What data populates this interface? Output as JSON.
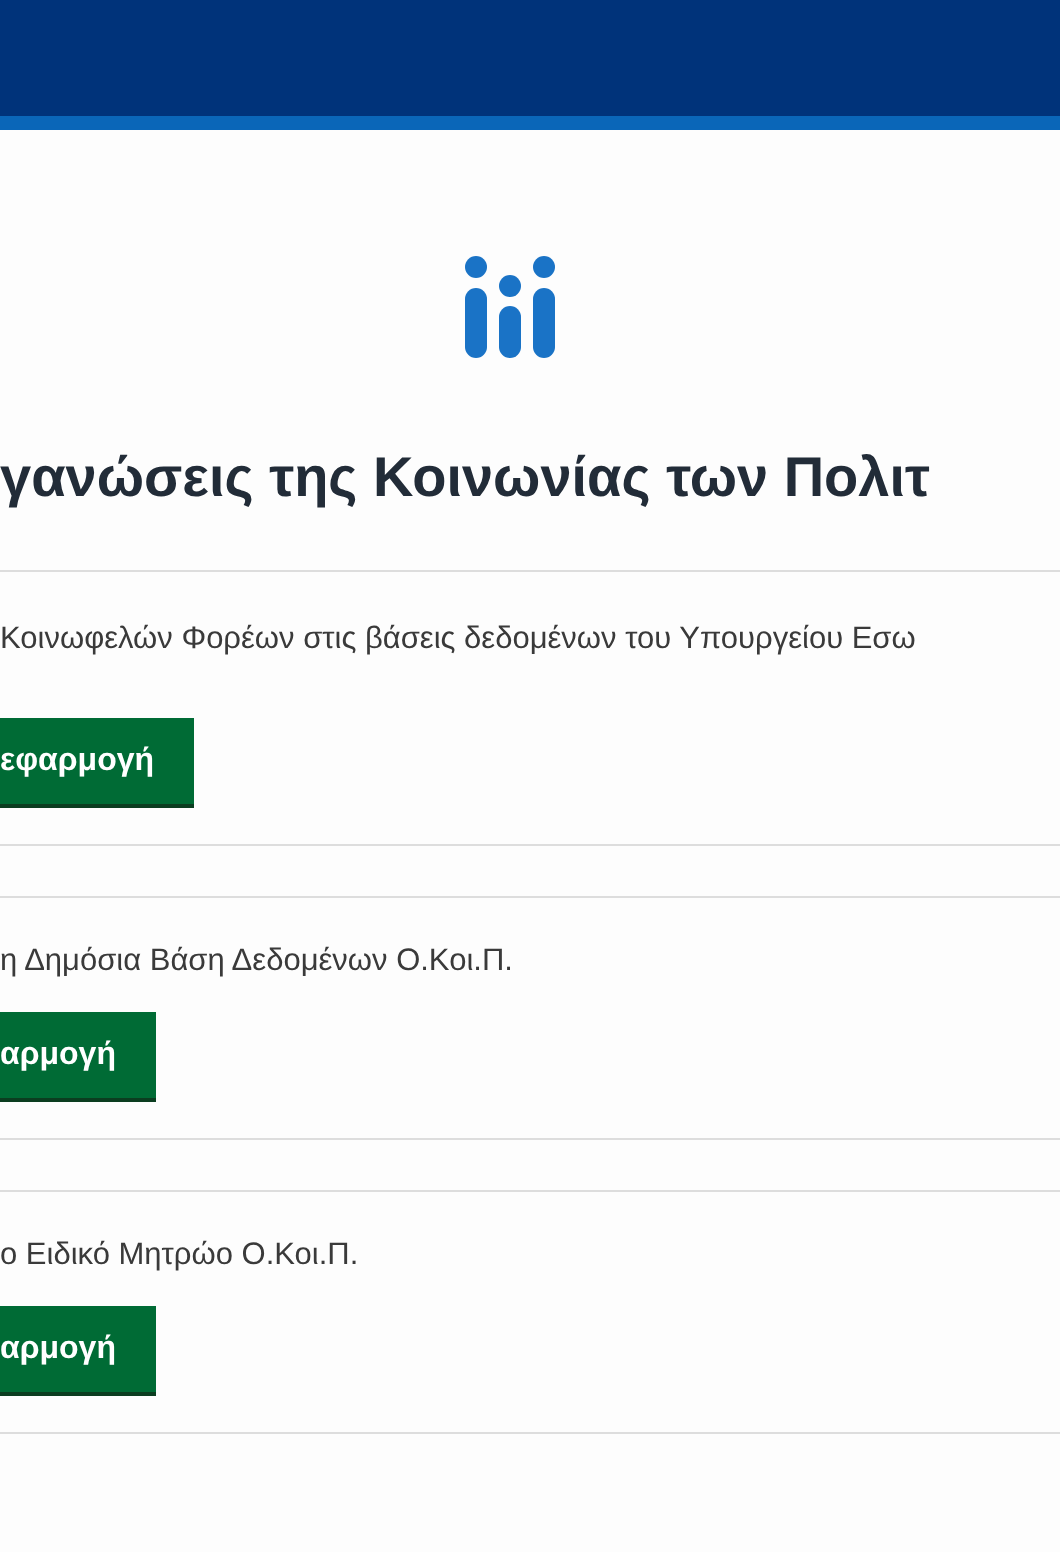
{
  "title": "γανώσεις της Κοινωνίας των Πολιτ",
  "sections": [
    {
      "text": "Κοινωφελών Φορέων στις βάσεις δεδομένων του Υπουργείου Εσω",
      "button": "εφαρμογή"
    },
    {
      "text": "η Δημόσια Βάση Δεδομένων Ο.Κοι.Π.",
      "button": "αρμογή"
    },
    {
      "text": "ο Ειδικό Μητρώο Ο.Κοι.Π.",
      "button": "αρμογή"
    }
  ]
}
